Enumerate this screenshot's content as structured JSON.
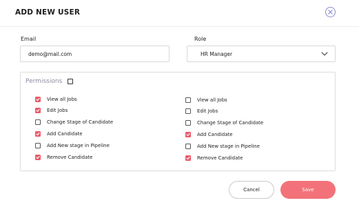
{
  "dialog": {
    "title": "ADD NEW USER"
  },
  "form": {
    "email": {
      "label": "Email",
      "value": "demo@mail.com"
    },
    "role": {
      "label": "Role",
      "value": "HR Manager"
    }
  },
  "permissions": {
    "label": "Permissions",
    "header_checked": false,
    "left": [
      {
        "label": "View all Jobs",
        "checked": true
      },
      {
        "label": "Edit Jobs",
        "checked": true
      },
      {
        "label": "Change Stage of Candidate",
        "checked": false
      },
      {
        "label": "Add Candidate",
        "checked": true
      },
      {
        "label": "Add New stage in Pipeline",
        "checked": false
      },
      {
        "label": "Remove Candidate",
        "checked": true
      }
    ],
    "right": [
      {
        "label": "View all Jobs",
        "checked": false
      },
      {
        "label": "Edit Jobs",
        "checked": false
      },
      {
        "label": "Change Stage of Candidate",
        "checked": false
      },
      {
        "label": "Add Candidate",
        "checked": true
      },
      {
        "label": "Add New stage in Pipeline",
        "checked": false
      },
      {
        "label": "Remove Candidate",
        "checked": true
      }
    ]
  },
  "actions": {
    "cancel_label": "Cancel",
    "save_label": "Save"
  },
  "colors": {
    "accent": "#ec5a6b",
    "save_button": "#f3727a",
    "close_icon": "#8a8ad0"
  }
}
